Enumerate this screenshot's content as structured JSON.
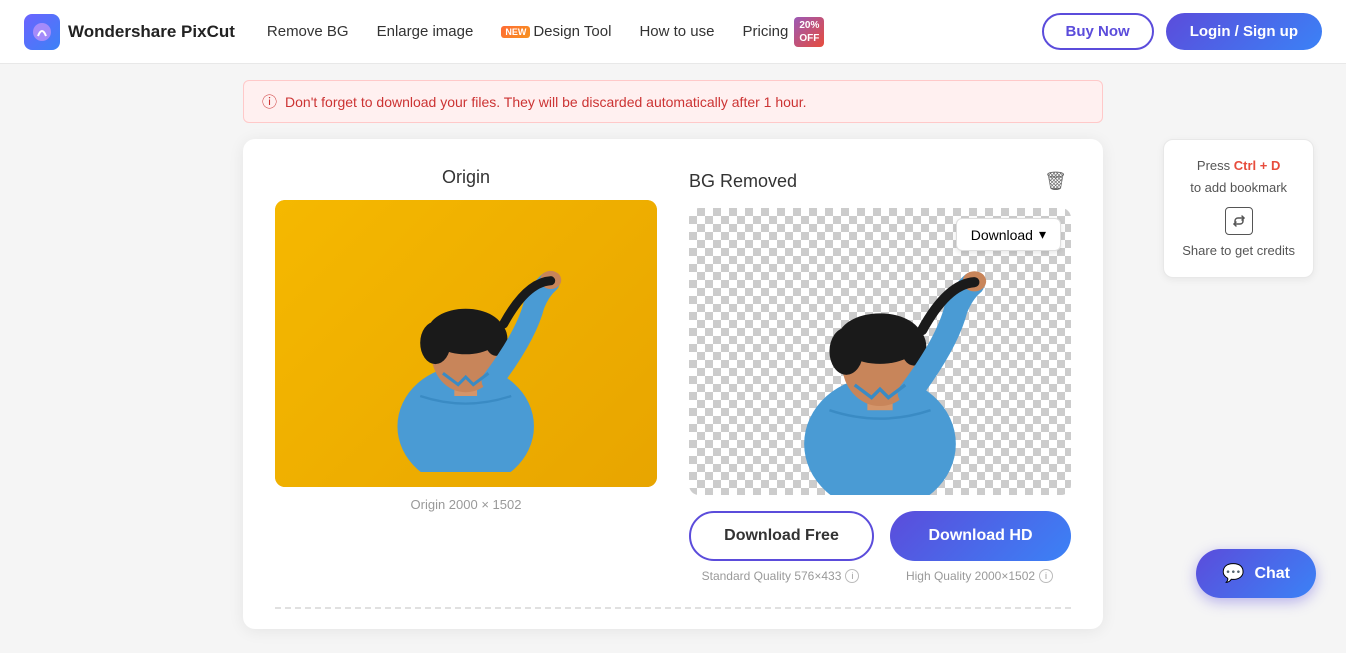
{
  "brand": {
    "name": "Wondershare PixCut",
    "logo_icon": "✦"
  },
  "nav": {
    "links": [
      {
        "id": "remove-bg",
        "label": "Remove BG",
        "new": false
      },
      {
        "id": "enlarge-image",
        "label": "Enlarge image",
        "new": false
      },
      {
        "id": "design-tool",
        "label": "Design Tool",
        "new": true
      },
      {
        "id": "how-to-use",
        "label": "How to use",
        "new": false
      },
      {
        "id": "pricing",
        "label": "Pricing",
        "new": false
      }
    ],
    "pricing_badge_line1": "20%",
    "pricing_badge_line2": "OFF",
    "buy_now_label": "Buy Now",
    "login_label": "Login / Sign up"
  },
  "banner": {
    "text": "Don't forget to download your files. They will be discarded automatically after 1 hour."
  },
  "editor": {
    "origin_title": "Origin",
    "bg_removed_title": "BG Removed",
    "origin_caption": "Origin 2000 × 1502",
    "download_button_label": "Download",
    "download_free_label": "Download Free",
    "download_hd_label": "Download HD",
    "quality_standard": "Standard Quality 576×433",
    "quality_high": "High Quality 2000×1502"
  },
  "bookmark_card": {
    "press_label": "Press",
    "shortcut": "Ctrl + D",
    "sub_label": "to add bookmark",
    "share_label": "Share to get credits"
  },
  "chat": {
    "label": "Chat"
  }
}
